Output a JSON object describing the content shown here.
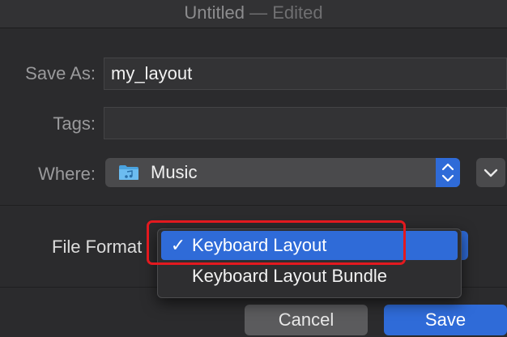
{
  "window": {
    "title": "Untitled",
    "status": "— Edited"
  },
  "form": {
    "save_as_label": "Save As:",
    "save_as_value": "my_layout",
    "tags_label": "Tags:",
    "tags_value": "",
    "where_label": "Where:",
    "where_value": "Music",
    "where_icon": "music-folder-icon"
  },
  "file_format": {
    "label": "File Format",
    "options": [
      {
        "label": "Keyboard Layout",
        "selected": true
      },
      {
        "label": "Keyboard Layout Bundle",
        "selected": false
      }
    ]
  },
  "buttons": {
    "cancel": "Cancel",
    "save": "Save"
  },
  "colors": {
    "accent": "#2f6bd8",
    "highlight": "#e3191f",
    "folder": "#4aa3e0"
  }
}
